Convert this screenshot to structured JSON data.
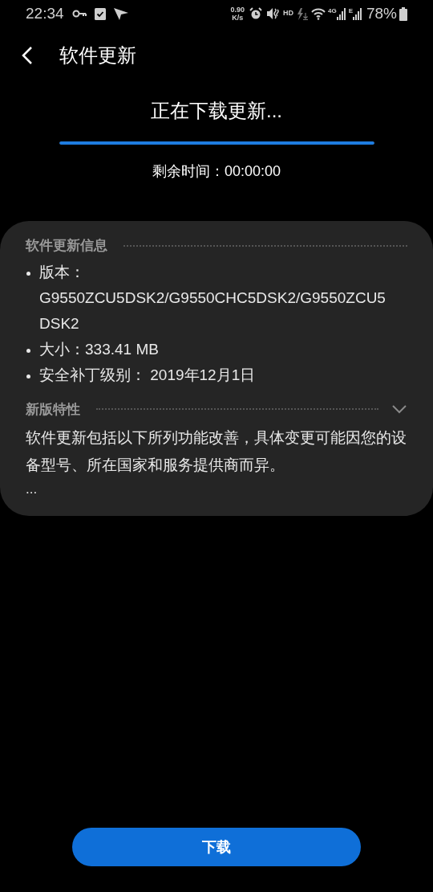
{
  "status_bar": {
    "time": "22:34",
    "net_speed": "0.90",
    "net_unit": "K/s",
    "hd": "HD",
    "mobile_1": "4G",
    "mobile_2": "E",
    "battery": "78%"
  },
  "header": {
    "title": "软件更新"
  },
  "download": {
    "title": "正在下载更新...",
    "level": 1,
    "remaining": "剩余时间：00:00:00"
  },
  "info_card": {
    "section_title": "软件更新信息",
    "items": [
      "版本：G9550ZCU5DSK2/G9550CHC5DSK2/G9550ZCU5DSK2",
      "大小：333.41 MB",
      "安全补丁级别： 2019年12月1日"
    ],
    "features_title": "新版特性",
    "features_expanded": false,
    "features_text": "软件更新包括以下所列功能改善，具体变更可能因您的设备型号、所在国家和服务提供商而异。",
    "features_more": "..."
  },
  "buttons": [
    "下载"
  ]
}
